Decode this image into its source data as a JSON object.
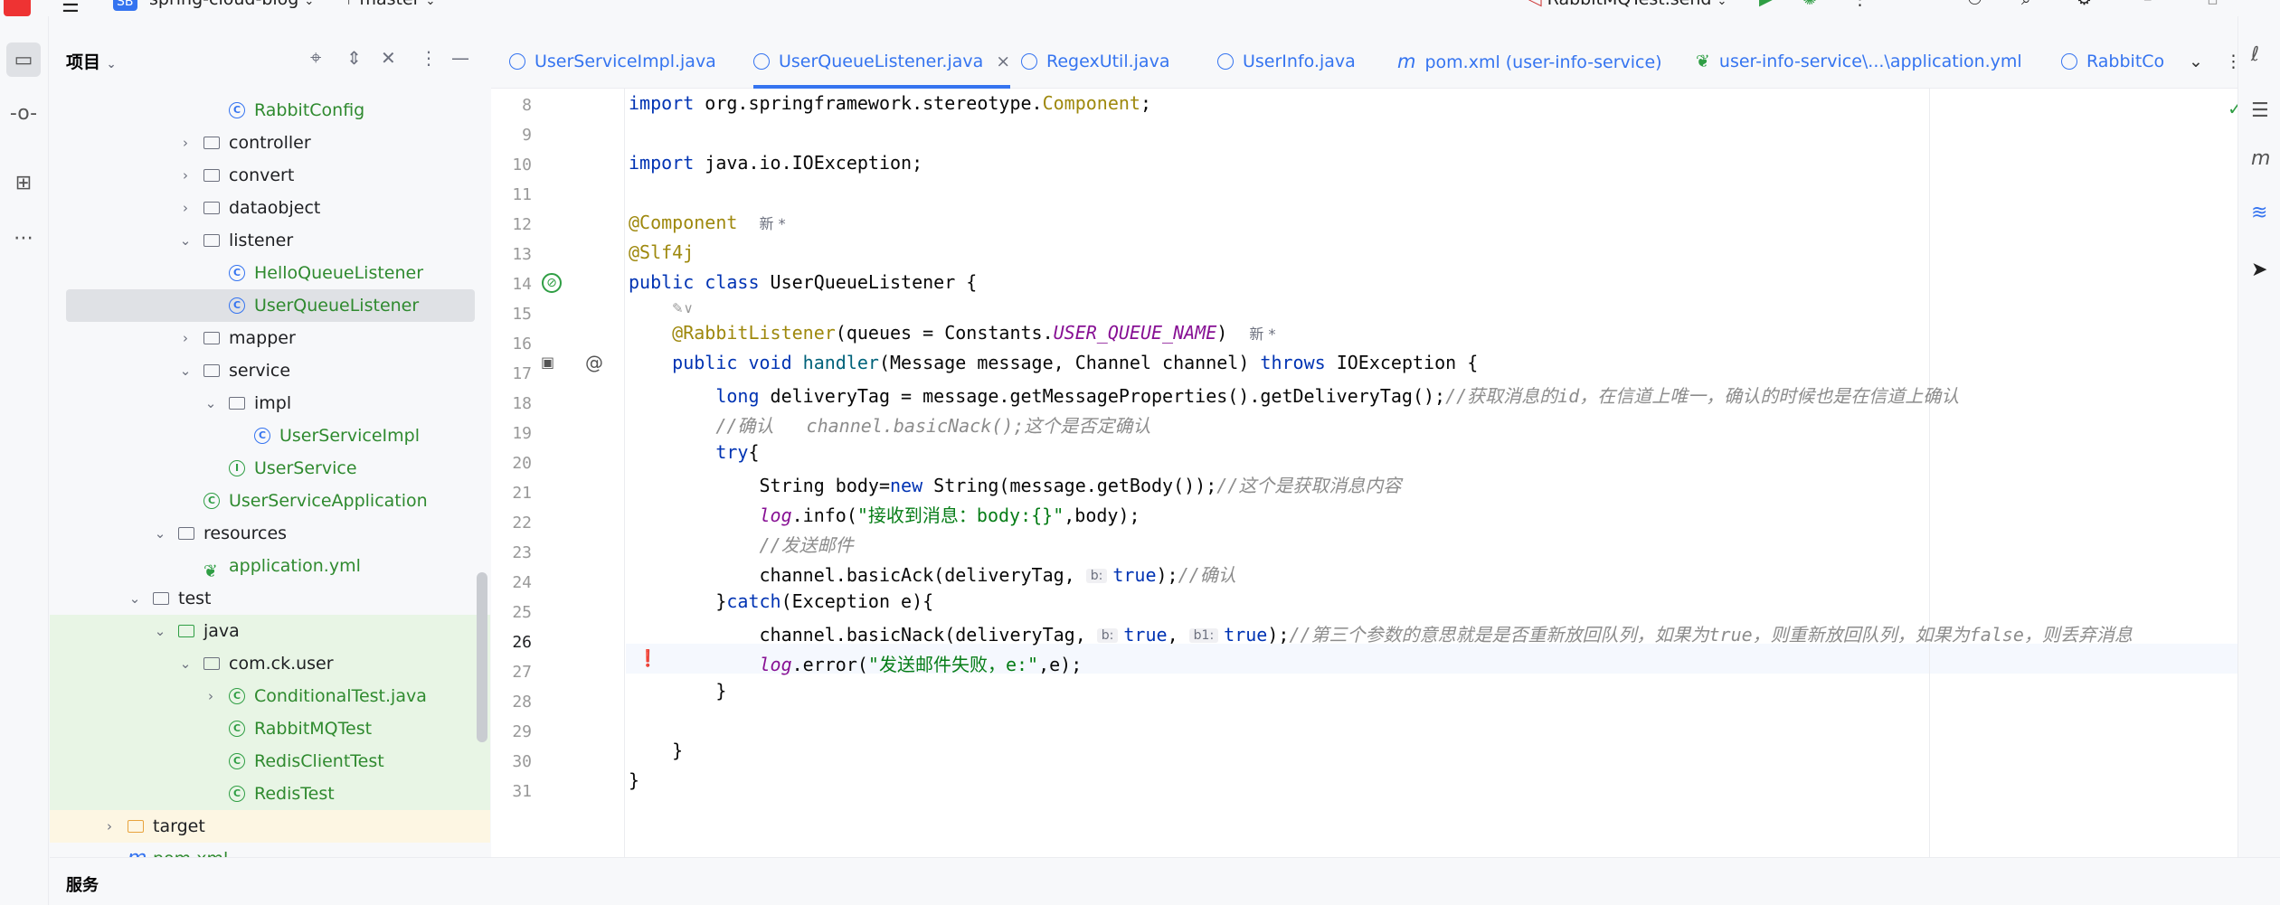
{
  "titlebar": {
    "project_badge": "SB",
    "project_name": "spring-cloud-blog",
    "branch": "master",
    "run_config": "RabbitMQTest.send"
  },
  "project_panel": {
    "title": "项目",
    "tree": [
      {
        "label": "RabbitConfig",
        "kind": "class",
        "depth": 4,
        "color": "green"
      },
      {
        "label": "controller",
        "kind": "package",
        "depth": 3,
        "expanded": false
      },
      {
        "label": "convert",
        "kind": "package",
        "depth": 3,
        "expanded": false
      },
      {
        "label": "dataobject",
        "kind": "package",
        "depth": 3,
        "expanded": false
      },
      {
        "label": "listener",
        "kind": "package",
        "depth": 3,
        "expanded": true
      },
      {
        "label": "HelloQueueListener",
        "kind": "class",
        "depth": 4,
        "color": "green"
      },
      {
        "label": "UserQueueListener",
        "kind": "class",
        "depth": 4,
        "color": "green",
        "selected": true
      },
      {
        "label": "mapper",
        "kind": "package",
        "depth": 3,
        "expanded": false
      },
      {
        "label": "service",
        "kind": "package",
        "depth": 3,
        "expanded": true
      },
      {
        "label": "impl",
        "kind": "package",
        "depth": 4,
        "expanded": true
      },
      {
        "label": "UserServiceImpl",
        "kind": "class",
        "depth": 5,
        "color": "green"
      },
      {
        "label": "UserService",
        "kind": "interface",
        "depth": 4,
        "color": "green"
      },
      {
        "label": "UserServiceApplication",
        "kind": "springclass",
        "depth": 3,
        "color": "green"
      },
      {
        "label": "resources",
        "kind": "folder",
        "depth": 2,
        "expanded": true
      },
      {
        "label": "application.yml",
        "kind": "yml",
        "depth": 3,
        "color": "green"
      },
      {
        "label": "test",
        "kind": "folder",
        "depth": 1,
        "expanded": true
      },
      {
        "label": "java",
        "kind": "folder",
        "depth": 2,
        "expanded": true,
        "highlight": "test"
      },
      {
        "label": "com.ck.user",
        "kind": "package",
        "depth": 3,
        "expanded": true,
        "highlight": "test"
      },
      {
        "label": "ConditionalTest.java",
        "kind": "testclass",
        "depth": 4,
        "color": "green",
        "collapsed": true,
        "highlight": "test"
      },
      {
        "label": "RabbitMQTest",
        "kind": "testclass",
        "depth": 4,
        "color": "green",
        "highlight": "test"
      },
      {
        "label": "RedisClientTest",
        "kind": "testclass",
        "depth": 4,
        "color": "green",
        "highlight": "test"
      },
      {
        "label": "RedisTest",
        "kind": "testclass",
        "depth": 4,
        "color": "green",
        "highlight": "test"
      },
      {
        "label": "target",
        "kind": "folder-orange",
        "depth": 0,
        "expanded": false,
        "highlight": "excluded"
      },
      {
        "label": "pom.xml",
        "kind": "maven",
        "depth": 0,
        "color": "green"
      }
    ]
  },
  "tabs": [
    {
      "label": "UserServiceImpl.java"
    },
    {
      "label": "UserQueueListener.java",
      "active": true
    },
    {
      "label": "RegexUtil.java"
    },
    {
      "label": "UserInfo.java"
    },
    {
      "label": "pom.xml (user-info-service)"
    },
    {
      "label": "user-info-service\\...\\application.yml"
    },
    {
      "label": "RabbitCo"
    }
  ],
  "editor": {
    "line_numbers": [
      "8",
      "9",
      "10",
      "11",
      "12",
      "13",
      "14",
      "15",
      "16",
      "17",
      "18",
      "19",
      "20",
      "21",
      "22",
      "23",
      "24",
      "25",
      "26",
      "27",
      "28",
      "29",
      "30",
      "31"
    ],
    "inlay_usages": "✎∨",
    "new_mark": "新 *",
    "lines": {
      "l8a": "import ",
      "l8b": "org.springframework.stereotype.",
      "l8c": "Component",
      "l8d": ";",
      "l10a": "import ",
      "l10b": "java.io.IOException;",
      "l12": "@Component",
      "l13": "@Slf4j",
      "l14a": "public class ",
      "l14b": "UserQueueListener {",
      "l15a": "@RabbitListener",
      "l15b": "(queues = Constants.",
      "l15c": "USER_QUEUE_NAME",
      "l15d": ")",
      "l16a": "public void ",
      "l16b": "handler",
      "l16c": "(Message message, Channel channel) ",
      "l16d": "throws ",
      "l16e": "IOException {",
      "l17a": "long ",
      "l17b": "deliveryTag = message.getMessageProperties().getDeliveryTag();",
      "l17c": "//获取消息的id，在信道上唯一，确认的时候也是在信道上确认",
      "l18": "//确认   channel.basicNack();这个是否定确认",
      "l19a": "try",
      "l19b": "{",
      "l20a": "String body=",
      "l20b": "new ",
      "l20c": "String(message.getBody());",
      "l20d": "//这个是获取消息内容",
      "l21a": "log",
      "l21b": ".info(",
      "l21c": "\"接收到消息：body:{}\"",
      "l21d": ",body);",
      "l22": "//发送邮件",
      "l23a": "channel.basicAck(deliveryTag, ",
      "l23hint": "b:",
      "l23b": "true",
      "l23c": ");",
      "l23d": "//确认",
      "l24a": "}",
      "l24b": "catch",
      "l24c": "(Exception e){",
      "l25a": "channel.basicNack(deliveryTag, ",
      "l25hint1": "b:",
      "l25b": "true",
      "l25c": ", ",
      "l25hint2": "b1:",
      "l25d": "true",
      "l25e": ");",
      "l25f": "//第三个参数的意思就是是否重新放回队列，如果为true，则重新放回队列，如果为false，则丢弃消息",
      "l26a": "log",
      "l26b": ".error(",
      "l26c": "\"发送邮件失败，e:\"",
      "l26d": ",e);",
      "l27": "}",
      "l29": "}",
      "l30": "}"
    }
  },
  "bottom": {
    "services_label": "服务"
  },
  "colors": {
    "accent": "#3574f0",
    "vcs_added": "#2f8a2f",
    "test_highlight": "#e8f5e5",
    "excluded_highlight": "#fdf6e3",
    "selected_row": "#dfe1e5"
  }
}
